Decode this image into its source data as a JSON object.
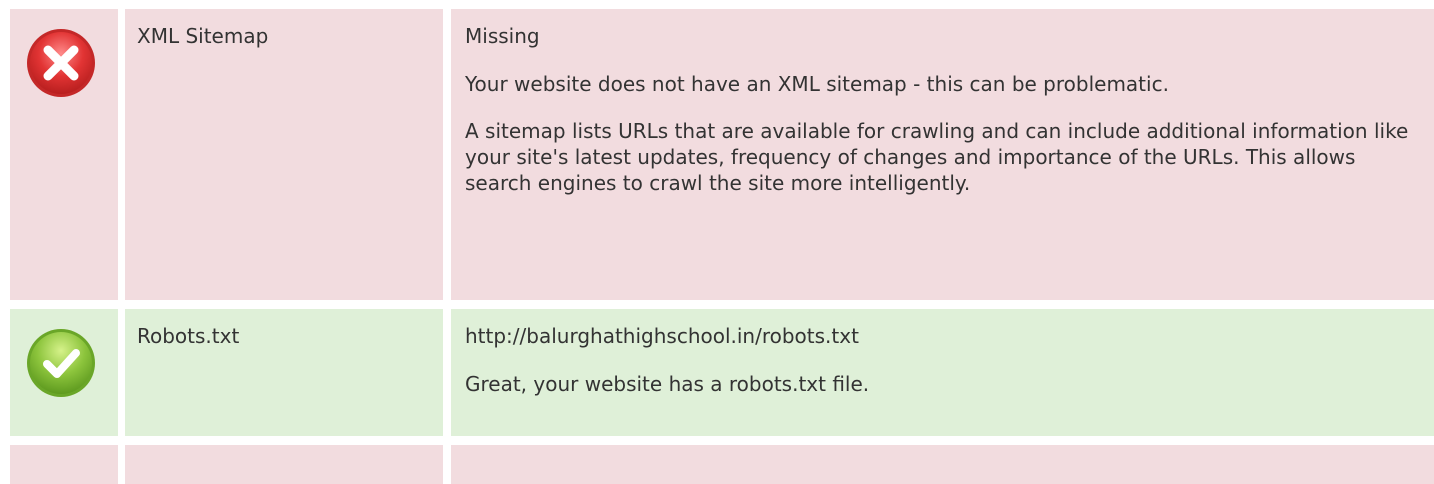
{
  "rows": [
    {
      "status": "fail",
      "icon": "error-x-icon",
      "name": "XML Sitemap",
      "value_title": "Missing",
      "paragraphs": [
        "Your website does not have an XML sitemap - this can be problematic.",
        "A sitemap lists URLs that are available for crawling and can include additional information like your site's latest updates, frequency of changes and importance of the URLs. This allows search engines to crawl the site more intelligently."
      ]
    },
    {
      "status": "pass",
      "icon": "success-check-icon",
      "name": "Robots.txt",
      "value_title": "http://balurghathighschool.in/robots.txt",
      "paragraphs": [
        "Great, your website has a robots.txt file."
      ]
    }
  ],
  "colors": {
    "fail_bg": "#f2dcdf",
    "pass_bg": "#dff0d8",
    "fail_icon": "#e03a3a",
    "pass_icon": "#8cc43c"
  }
}
